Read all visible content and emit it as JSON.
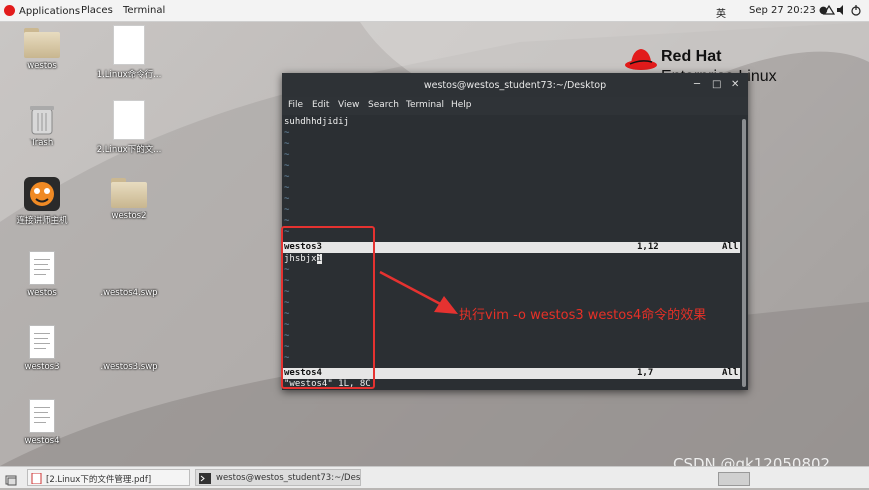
{
  "topbar": {
    "applications": "Applications",
    "places": "Places",
    "terminal": "Terminal",
    "input_method": "英",
    "clock": "Sep 27  20:23",
    "status_dot": "●"
  },
  "desktop": {
    "icons": [
      {
        "label": "westos"
      },
      {
        "label": "1.Linux命令行..."
      },
      {
        "label": "Trash"
      },
      {
        "label": "2.Linux下的文..."
      },
      {
        "label": "连接讲师主机"
      },
      {
        "label": "westos2"
      },
      {
        "label": "westos"
      },
      {
        "label": ".westos4.swp"
      },
      {
        "label": "westos3"
      },
      {
        "label": ".westos3.swp"
      },
      {
        "label": "westos4"
      }
    ]
  },
  "logo": {
    "line1": "Red Hat",
    "line2": "Enterprise Linux"
  },
  "terminal": {
    "title": "westos@westos_student73:~/Desktop",
    "menu": [
      "File",
      "Edit",
      "View",
      "Search",
      "Terminal",
      "Help"
    ],
    "pane1": {
      "line1": "suhdhhdjidij",
      "status_name": "westos3",
      "status_pos": "1,12",
      "status_all": "All"
    },
    "pane2": {
      "line1": "jhsbjx",
      "cursor_char": "i",
      "status_name": "westos4",
      "status_pos": "1,7",
      "status_all": "All"
    },
    "message": "\"westos4\" 1L, 8C"
  },
  "annotation": {
    "text": "执行vim -o westos3 westos4命令的效果"
  },
  "taskbar": {
    "item1": "[2.Linux下的文件管理.pdf]",
    "item2": "westos@westos_student73:~/Desk..."
  },
  "watermark": "CSDN @gk12050802",
  "colors": {
    "accent_red": "#e53230",
    "terminal_bg": "#2b2f33",
    "redhat_red": "#e21b1b"
  }
}
